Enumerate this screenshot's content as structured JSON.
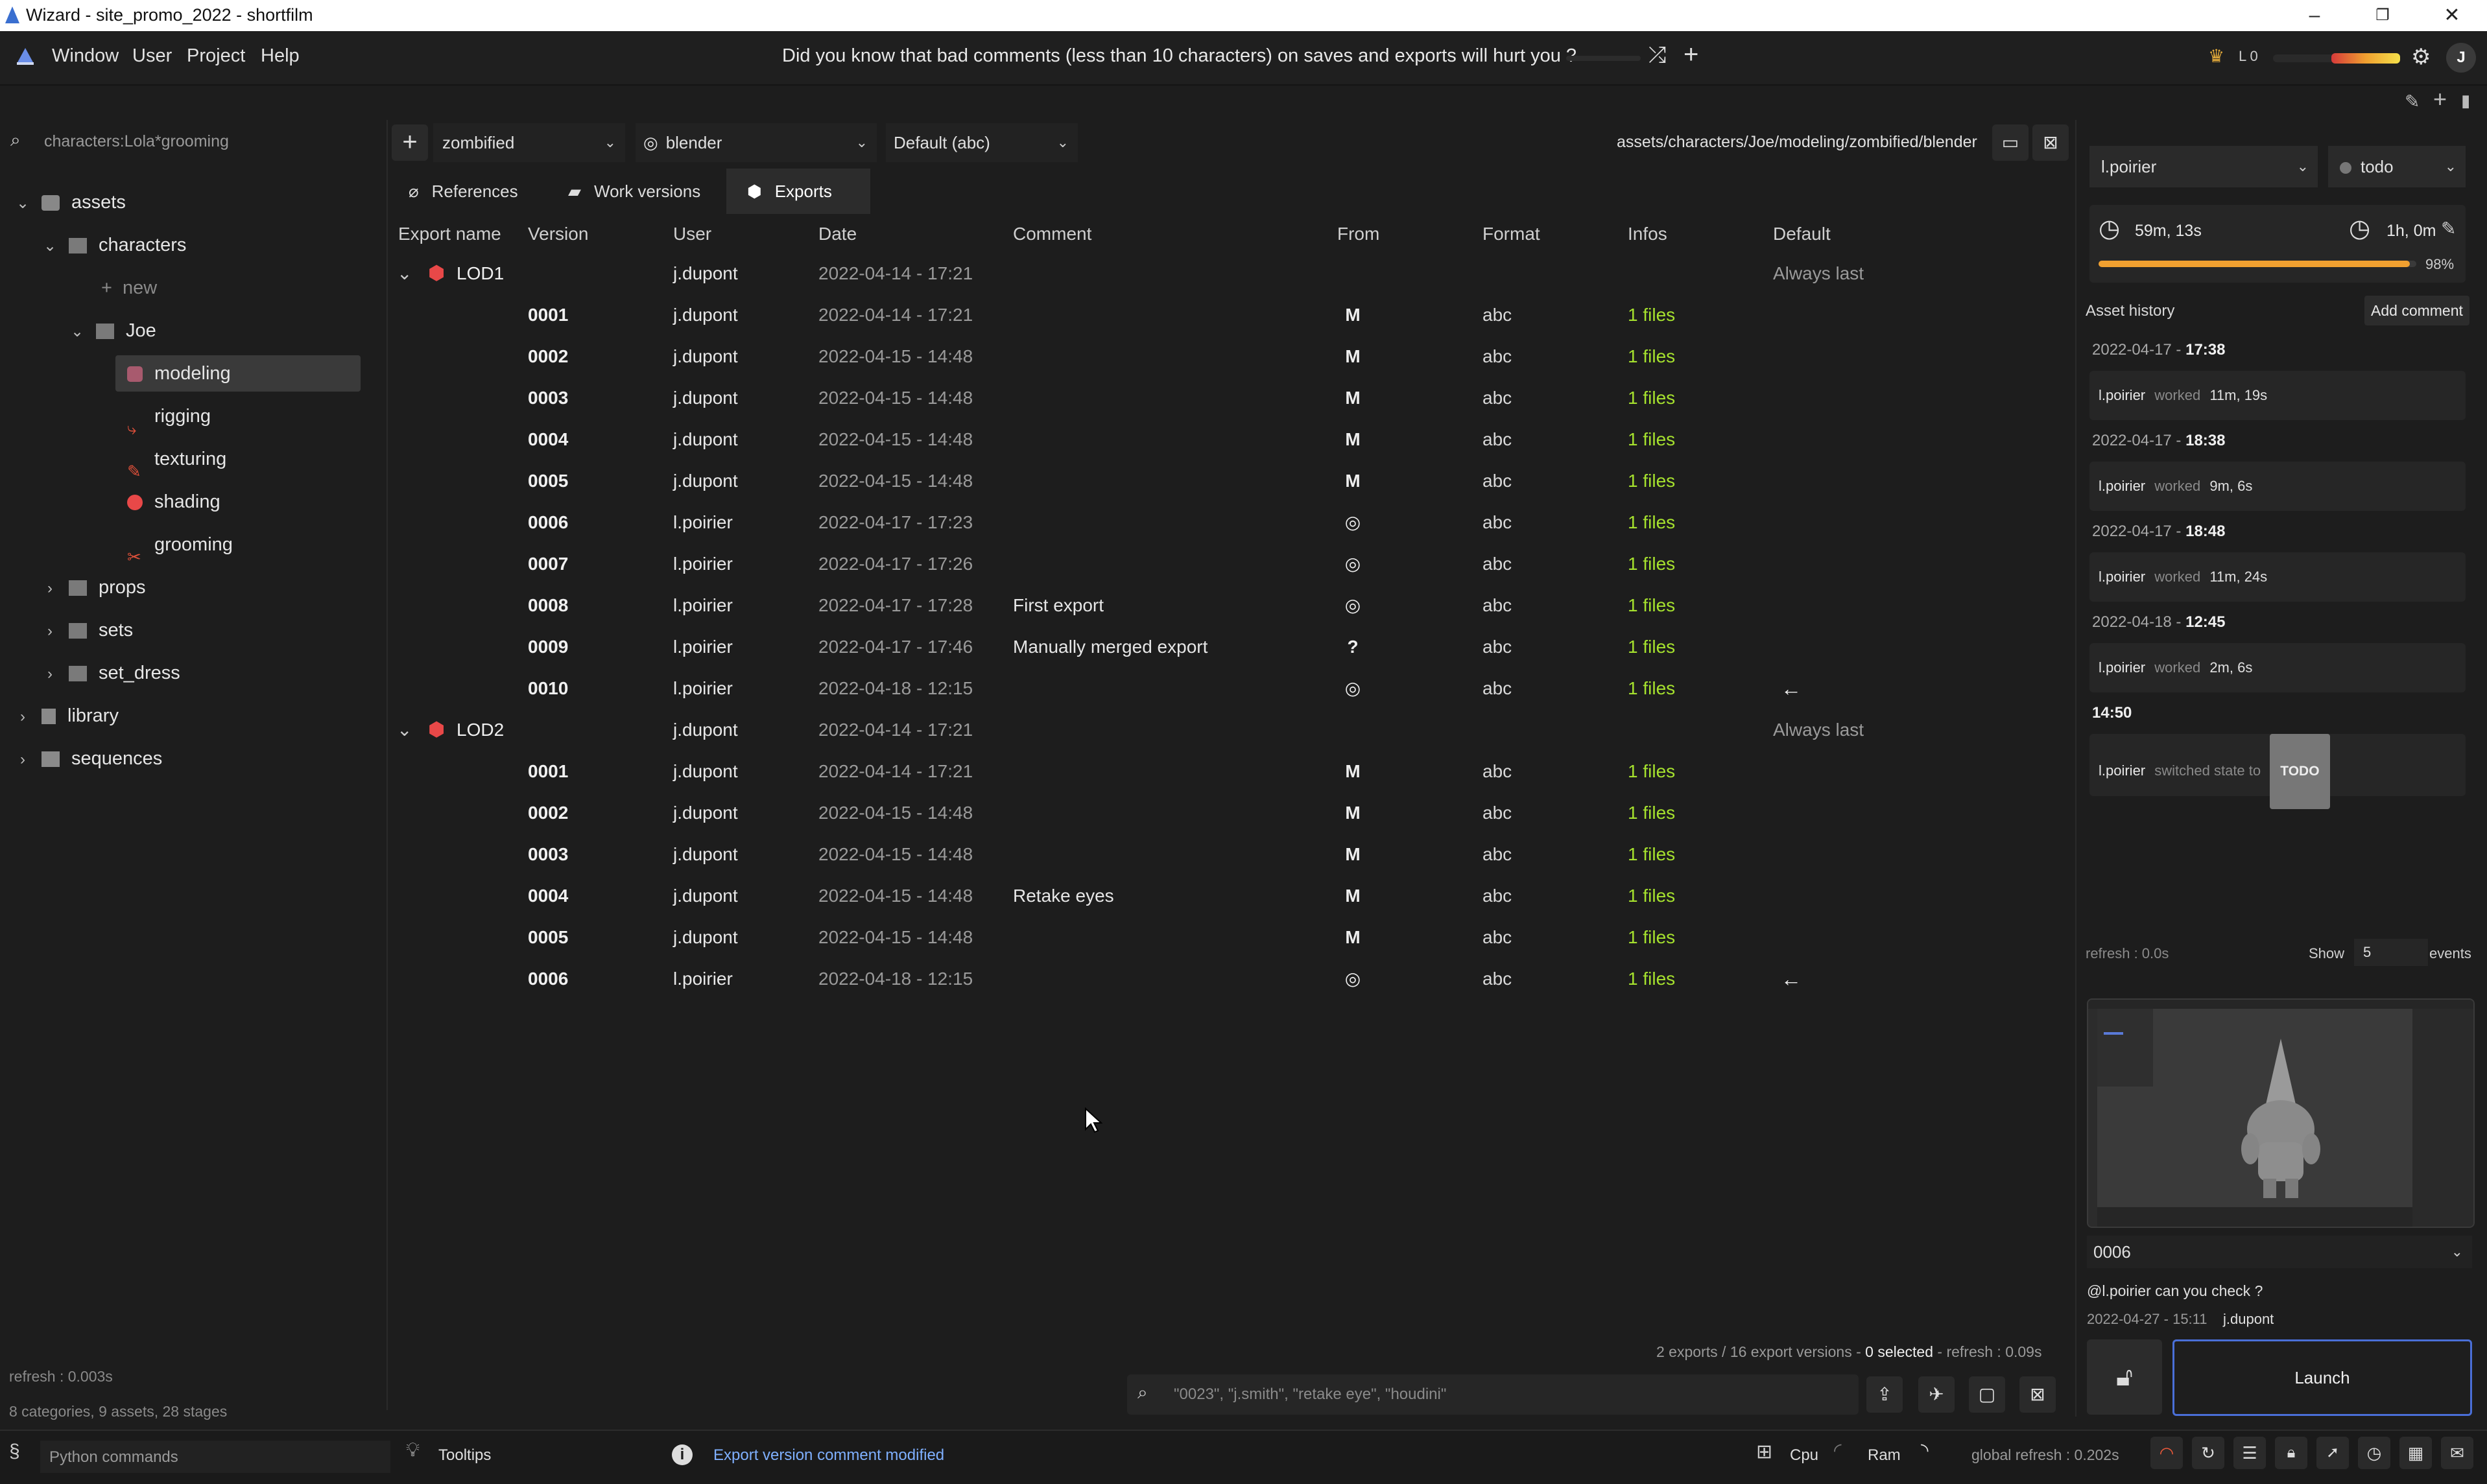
{
  "window": {
    "title": "Wizard - site_promo_2022 - shortfilm"
  },
  "menu": {
    "items": [
      "Window",
      "User",
      "Project",
      "Help"
    ],
    "tip": "Did you know that bad comments (less than 10 characters) on saves and exports will hurt you ?",
    "level": "L 0",
    "avatar": "J"
  },
  "left": {
    "search": "characters:Lola*grooming",
    "tree": [
      {
        "label": "assets"
      },
      {
        "label": "characters"
      },
      {
        "label": "new"
      },
      {
        "label": "Joe"
      },
      {
        "label": "modeling"
      },
      {
        "label": "rigging"
      },
      {
        "label": "texturing"
      },
      {
        "label": "shading"
      },
      {
        "label": "grooming"
      },
      {
        "label": "props"
      },
      {
        "label": "sets"
      },
      {
        "label": "set_dress"
      },
      {
        "label": "library"
      },
      {
        "label": "sequences"
      }
    ],
    "refresh": "refresh : 0.003s",
    "summary": "8 categories, 9 assets, 28 stages"
  },
  "center": {
    "variant": "zombified",
    "software": "blender",
    "extension": "Default (abc)",
    "path": "assets/characters/Joe/modeling/zombified/blender",
    "tabs": [
      "References",
      "Work versions",
      "Exports"
    ],
    "columns": [
      "Export name",
      "Version",
      "User",
      "Date",
      "Comment",
      "From",
      "Format",
      "Infos",
      "Default"
    ],
    "groups": [
      {
        "name": "LOD1",
        "user": "j.dupont",
        "date": "2022-04-14 - 17:21",
        "default": "Always last",
        "rows": [
          {
            "v": "0001",
            "user": "j.dupont",
            "date": "2022-04-14 - 17:21",
            "comment": "",
            "from": "M",
            "format": "abc",
            "infos": "1 files",
            "default": ""
          },
          {
            "v": "0002",
            "user": "j.dupont",
            "date": "2022-04-15 - 14:48",
            "comment": "",
            "from": "M",
            "format": "abc",
            "infos": "1 files",
            "default": ""
          },
          {
            "v": "0003",
            "user": "j.dupont",
            "date": "2022-04-15 - 14:48",
            "comment": "",
            "from": "M",
            "format": "abc",
            "infos": "1 files",
            "default": ""
          },
          {
            "v": "0004",
            "user": "j.dupont",
            "date": "2022-04-15 - 14:48",
            "comment": "",
            "from": "M",
            "format": "abc",
            "infos": "1 files",
            "default": ""
          },
          {
            "v": "0005",
            "user": "j.dupont",
            "date": "2022-04-15 - 14:48",
            "comment": "",
            "from": "M",
            "format": "abc",
            "infos": "1 files",
            "default": ""
          },
          {
            "v": "0006",
            "user": "l.poirier",
            "date": "2022-04-17 - 17:23",
            "comment": "",
            "from": "blender",
            "format": "abc",
            "infos": "1 files",
            "default": ""
          },
          {
            "v": "0007",
            "user": "l.poirier",
            "date": "2022-04-17 - 17:26",
            "comment": "",
            "from": "blender",
            "format": "abc",
            "infos": "1 files",
            "default": ""
          },
          {
            "v": "0008",
            "user": "l.poirier",
            "date": "2022-04-17 - 17:28",
            "comment": "First export",
            "from": "blender",
            "format": "abc",
            "infos": "1 files",
            "default": ""
          },
          {
            "v": "0009",
            "user": "l.poirier",
            "date": "2022-04-17 - 17:46",
            "comment": "Manually merged export",
            "from": "?",
            "format": "abc",
            "infos": "1 files",
            "default": ""
          },
          {
            "v": "0010",
            "user": "l.poirier",
            "date": "2022-04-18 - 12:15",
            "comment": "",
            "from": "blender",
            "format": "abc",
            "infos": "1 files",
            "default": "←"
          }
        ]
      },
      {
        "name": "LOD2",
        "user": "j.dupont",
        "date": "2022-04-14 - 17:21",
        "default": "Always last",
        "rows": [
          {
            "v": "0001",
            "user": "j.dupont",
            "date": "2022-04-14 - 17:21",
            "comment": "",
            "from": "M",
            "format": "abc",
            "infos": "1 files",
            "default": ""
          },
          {
            "v": "0002",
            "user": "j.dupont",
            "date": "2022-04-15 - 14:48",
            "comment": "",
            "from": "M",
            "format": "abc",
            "infos": "1 files",
            "default": ""
          },
          {
            "v": "0003",
            "user": "j.dupont",
            "date": "2022-04-15 - 14:48",
            "comment": "",
            "from": "M",
            "format": "abc",
            "infos": "1 files",
            "default": ""
          },
          {
            "v": "0004",
            "user": "j.dupont",
            "date": "2022-04-15 - 14:48",
            "comment": "Retake eyes",
            "from": "M",
            "format": "abc",
            "infos": "1 files",
            "default": ""
          },
          {
            "v": "0005",
            "user": "j.dupont",
            "date": "2022-04-15 - 14:48",
            "comment": "",
            "from": "M",
            "format": "abc",
            "infos": "1 files",
            "default": ""
          },
          {
            "v": "0006",
            "user": "l.poirier",
            "date": "2022-04-18 - 12:15",
            "comment": "",
            "from": "blender",
            "format": "abc",
            "infos": "1 files",
            "default": "←"
          }
        ]
      }
    ],
    "status": "2 exports / 16 export versions - ",
    "selected": "0 selected",
    "refresh": " - refresh : 0.09s",
    "search_placeholder": "\"0023\", \"j.smith\", \"retake eye\", \"houdini\""
  },
  "right": {
    "user": "l.poirier",
    "state": "todo",
    "time_worked": "59m, 13s",
    "estimated": "1h, 0m",
    "progress": 0.98,
    "progress_label": "98%",
    "history_title": "Asset history",
    "add_comment": "Add comment",
    "history": [
      {
        "date": "2022-04-17 - ",
        "time": "17:38",
        "user": "l.poirier",
        "action": "worked",
        "value": "11m, 19s"
      },
      {
        "date": "2022-04-17 - ",
        "time": "18:38",
        "user": "l.poirier",
        "action": "worked",
        "value": "9m, 6s"
      },
      {
        "date": "2022-04-17 - ",
        "time": "18:48",
        "user": "l.poirier",
        "action": "worked",
        "value": "11m, 24s"
      },
      {
        "date": "2022-04-18 - ",
        "time": "12:45",
        "user": "l.poirier",
        "action": "worked",
        "value": "2m, 6s"
      },
      {
        "date": "",
        "time": "14:50",
        "user": "l.poirier",
        "action": "switched state to",
        "value": "TODO"
      }
    ],
    "refresh": "refresh : 0.0s",
    "show": "Show",
    "events_count": "5",
    "events": "events",
    "version": "0006",
    "comment": "@l.poirier can you check ?",
    "comment_date": "2022-04-27 - 15:11",
    "comment_user": "j.dupont",
    "launch": "Launch"
  },
  "bottom": {
    "python_placeholder": "Python commands",
    "tooltips": "Tooltips",
    "message": "Export version comment modified",
    "cpu": "Cpu",
    "ram": "Ram",
    "global_refresh": "global refresh : 0.202s"
  },
  "colors": {
    "accent": "#f0a030",
    "green": "#a6e22e",
    "red": "#e04848",
    "launch_border": "#4a6fd8"
  }
}
